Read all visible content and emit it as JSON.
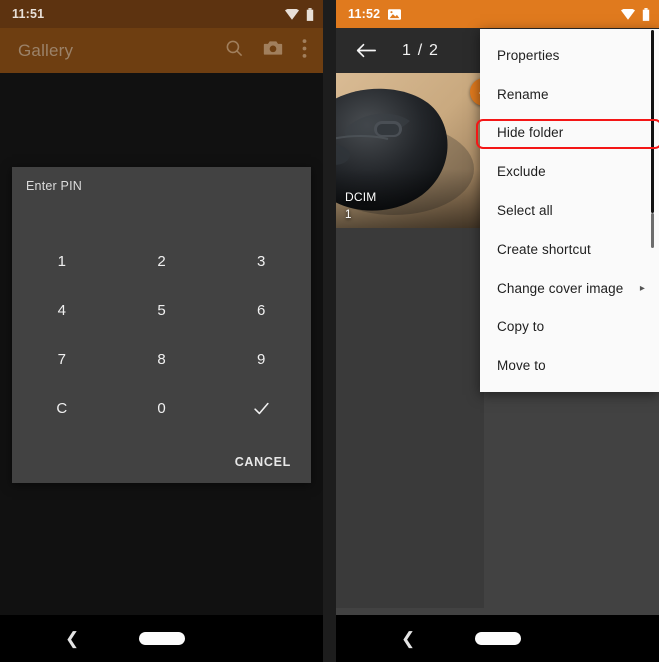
{
  "left_phone": {
    "status_bar": {
      "time": "11:51",
      "wifi_icon": "wifi-icon",
      "battery_icon": "battery-icon"
    },
    "toolbar": {
      "title": "Gallery",
      "search_icon": "search-icon",
      "camera_icon": "camera-icon",
      "overflow_icon": "more-vertical-icon"
    },
    "pin_dialog": {
      "title": "Enter PIN",
      "keys": [
        "1",
        "2",
        "3",
        "4",
        "5",
        "6",
        "7",
        "8",
        "9",
        "C",
        "0",
        "✓"
      ],
      "confirm_icon": "check-icon",
      "cancel_label": "CANCEL"
    },
    "navbar": {
      "back_icon": "back-chevron-icon",
      "home_pill": "home-pill"
    }
  },
  "right_phone": {
    "status_bar": {
      "time": "11:52",
      "photo_icon": "photo-icon",
      "wifi_icon": "wifi-icon",
      "battery_icon": "battery-icon"
    },
    "toolbar": {
      "back_icon": "back-arrow-icon",
      "counter": "1 / 2"
    },
    "thumbnail": {
      "folder_name": "DCIM",
      "item_count": "1",
      "selected_badge_icon": "check-circle-icon",
      "image_description": "black computer mouse on wooden desk"
    },
    "menu": {
      "items": [
        {
          "label": "Properties",
          "has_submenu": false
        },
        {
          "label": "Rename",
          "has_submenu": false
        },
        {
          "label": "Hide folder",
          "has_submenu": false,
          "highlighted": true
        },
        {
          "label": "Exclude",
          "has_submenu": false
        },
        {
          "label": "Select all",
          "has_submenu": false
        },
        {
          "label": "Create shortcut",
          "has_submenu": false
        },
        {
          "label": "Change cover image",
          "has_submenu": true,
          "submenu_arrow": "▸"
        },
        {
          "label": "Copy to",
          "has_submenu": false
        },
        {
          "label": "Move to",
          "has_submenu": false
        }
      ],
      "highlight_color": "#f41616"
    },
    "navbar": {
      "back_icon": "back-chevron-icon",
      "home_pill": "home-pill"
    }
  },
  "colors": {
    "accent_orange": "#e07a1e",
    "dimmed_brown": "#6e3e11",
    "dialog_gray": "#424242",
    "menu_white": "#fafafa"
  }
}
